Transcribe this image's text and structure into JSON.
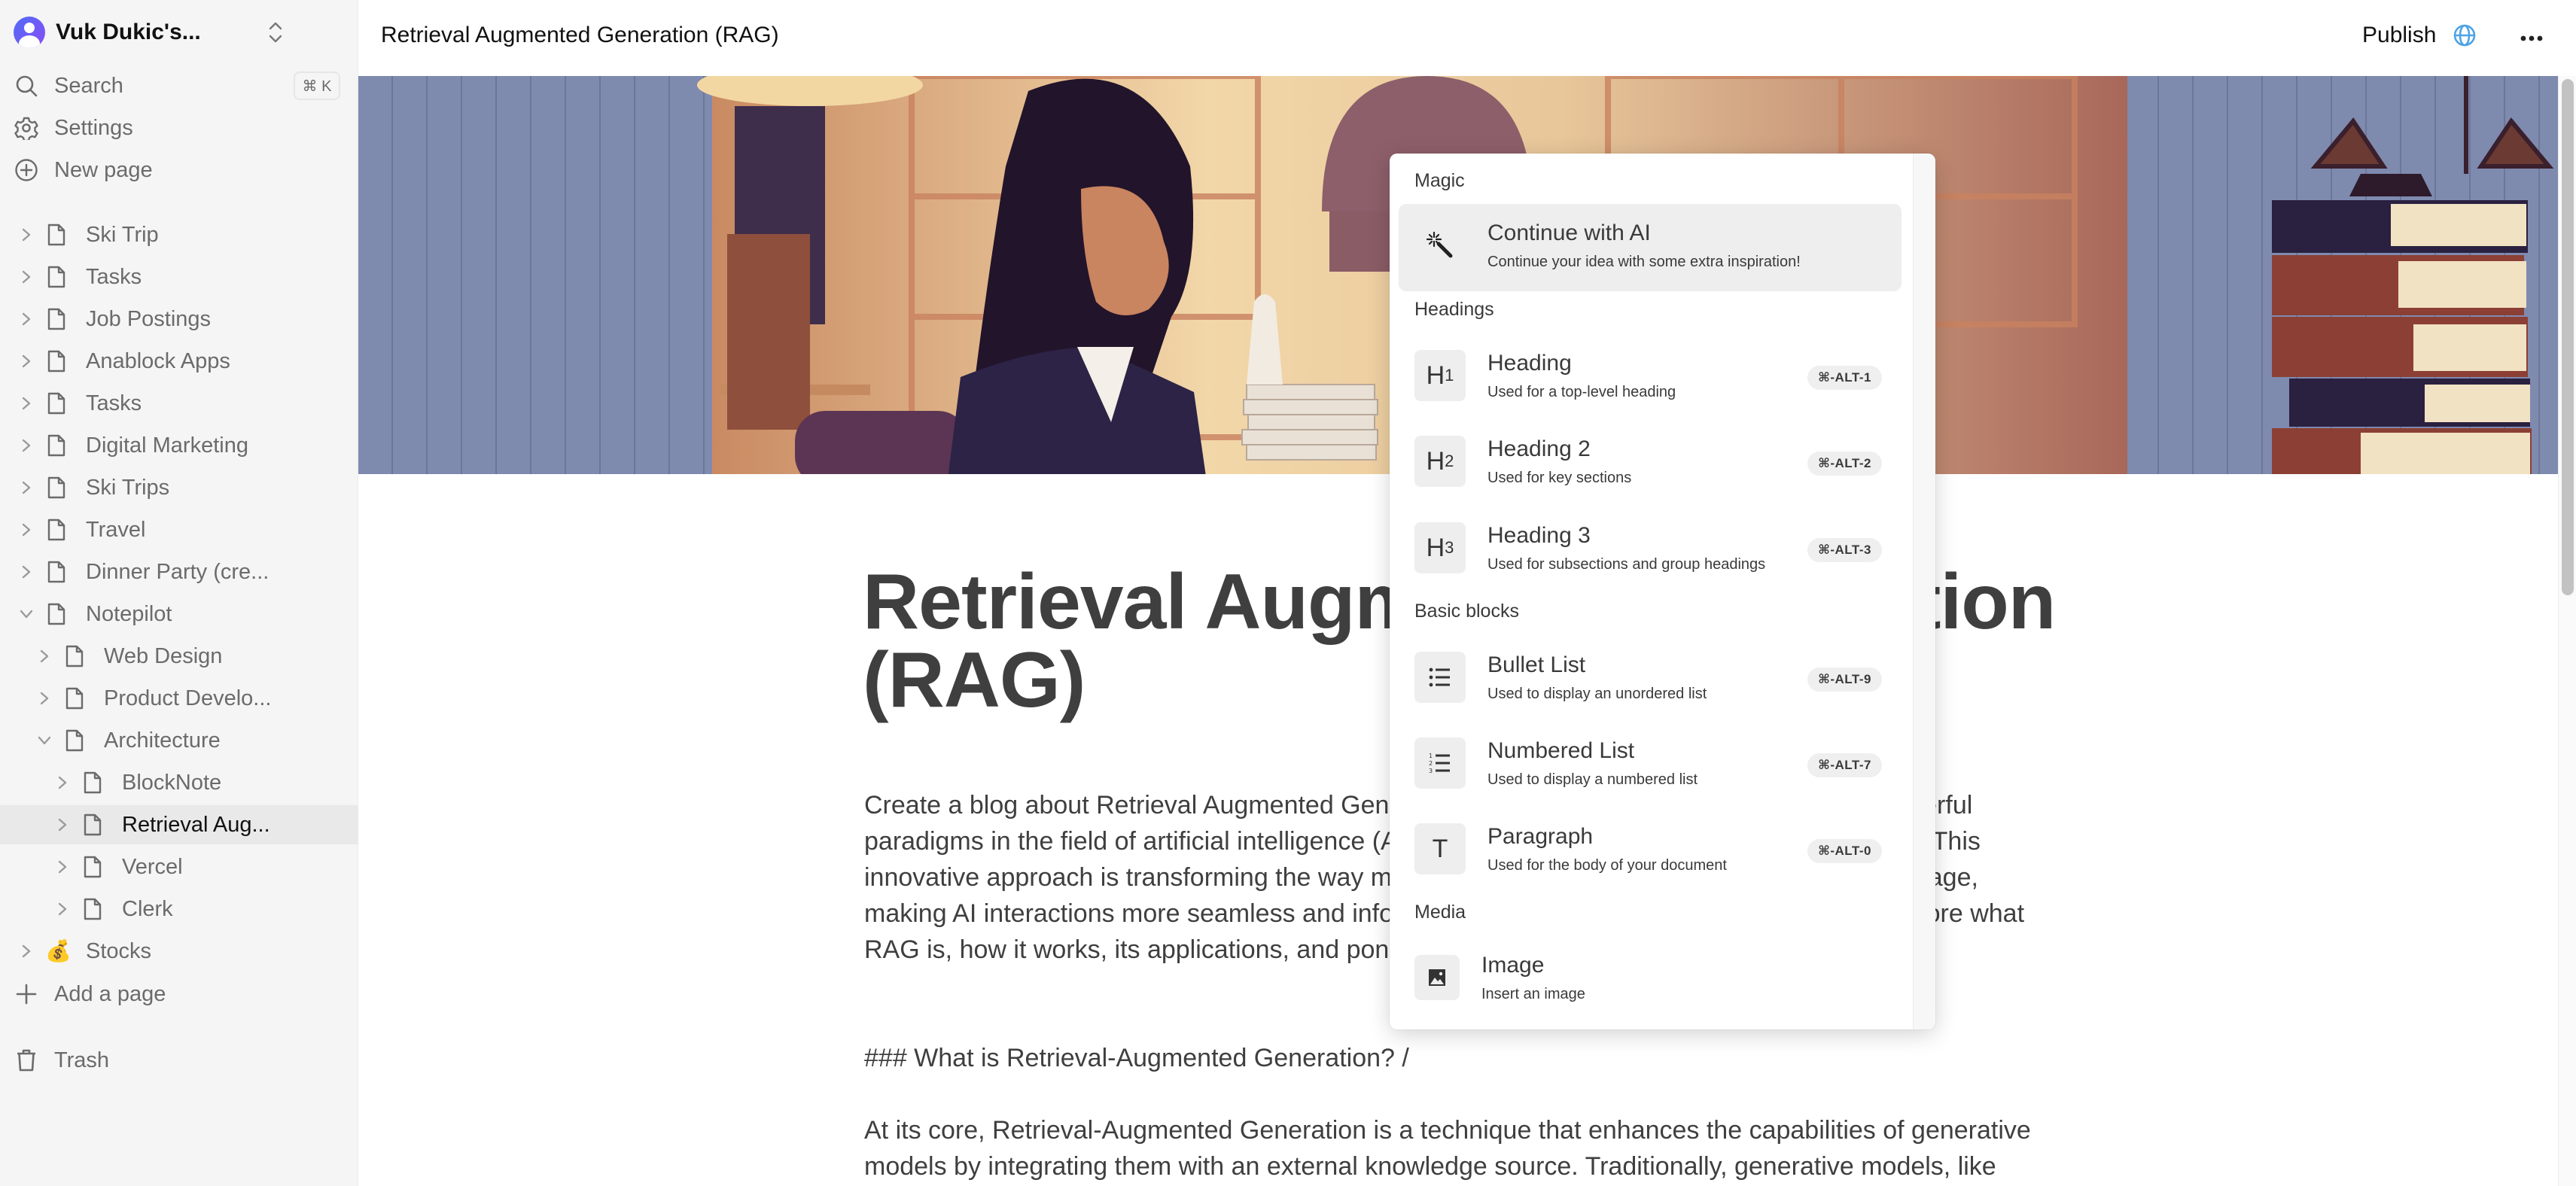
{
  "workspace": {
    "name": "Vuk Dukic's...",
    "avatar_icon": "user-avatar-icon",
    "switch_icon": "chevron-up-down-icon"
  },
  "sidebar": {
    "search": {
      "label": "Search",
      "shortcut": "⌘ K",
      "icon": "search-icon"
    },
    "settings": {
      "label": "Settings",
      "icon": "gear-icon"
    },
    "new_page": {
      "label": "New page",
      "icon": "plus-circle-icon"
    },
    "tree": [
      {
        "label": "Ski Trip",
        "depth": 0,
        "expanded": false,
        "icon": "page-icon"
      },
      {
        "label": "Tasks",
        "depth": 0,
        "expanded": false,
        "icon": "page-icon"
      },
      {
        "label": "Job Postings",
        "depth": 0,
        "expanded": false,
        "icon": "page-icon"
      },
      {
        "label": "Anablock Apps",
        "depth": 0,
        "expanded": false,
        "icon": "page-icon"
      },
      {
        "label": "Tasks",
        "depth": 0,
        "expanded": false,
        "icon": "page-icon"
      },
      {
        "label": "Digital Marketing",
        "depth": 0,
        "expanded": false,
        "icon": "page-icon"
      },
      {
        "label": "Ski Trips",
        "depth": 0,
        "expanded": false,
        "icon": "page-icon"
      },
      {
        "label": "Travel",
        "depth": 0,
        "expanded": false,
        "icon": "page-icon"
      },
      {
        "label": "Dinner Party (cre...",
        "depth": 0,
        "expanded": false,
        "icon": "page-icon"
      },
      {
        "label": "Notepilot",
        "depth": 0,
        "expanded": true,
        "icon": "page-icon"
      },
      {
        "label": "Web Design",
        "depth": 1,
        "expanded": false,
        "icon": "page-icon"
      },
      {
        "label": "Product Develo...",
        "depth": 1,
        "expanded": false,
        "icon": "page-icon"
      },
      {
        "label": "Architecture",
        "depth": 1,
        "expanded": true,
        "icon": "page-icon"
      },
      {
        "label": "BlockNote",
        "depth": 2,
        "expanded": false,
        "icon": "page-icon"
      },
      {
        "label": "Retrieval Aug...",
        "depth": 2,
        "expanded": false,
        "icon": "page-icon",
        "active": true
      },
      {
        "label": "Vercel",
        "depth": 2,
        "expanded": false,
        "icon": "page-icon"
      },
      {
        "label": "Clerk",
        "depth": 2,
        "expanded": false,
        "icon": "page-icon"
      },
      {
        "label": "Stocks",
        "depth": 0,
        "expanded": false,
        "icon": "money-bag-emoji",
        "emoji": "💰"
      }
    ],
    "add_page": {
      "label": "Add a page",
      "icon": "plus-icon"
    },
    "trash": {
      "label": "Trash",
      "icon": "trash-icon"
    }
  },
  "topbar": {
    "page_title": "Retrieval Augmented Generation (RAG)",
    "publish_label": "Publish",
    "publish_icon": "globe-icon",
    "more_icon": "more-horizontal-icon",
    "accent_color": "#4ea3e6"
  },
  "document": {
    "cover_image": "illustration of a lawyer at a desk with books and scales of justice",
    "title": "Retrieval Augmented Generation (RAG)",
    "paragraphs": [
      "Create a blog about Retrieval Augmented Generation (RAG) is a fascinating blend of two powerful paradigms in the field of artificial intelligence (AI): information retrieval and generative models. This innovative approach is transforming the way machines understand and generate human language, making AI interactions more seamless and informative than ever before. In this blog, we'll explore what RAG is, how it works, its applications, and ponder its future.",
      "### What is Retrieval-Augmented Generation? /",
      "At its core, Retrieval-Augmented Generation is a technique that enhances the capabilities of generative models by integrating them with an external knowledge source. Traditionally, generative models, like"
    ]
  },
  "slash_menu": {
    "groups": [
      {
        "label": "Magic",
        "items": [
          {
            "title": "Continue with AI",
            "subtitle": "Continue your idea with some extra inspiration!",
            "icon": "magic-wand-icon",
            "shortcut": "",
            "selected": true
          }
        ]
      },
      {
        "label": "Headings",
        "items": [
          {
            "title": "Heading",
            "subtitle": "Used for a top-level heading",
            "icon": "heading-1-icon",
            "glyph": "H",
            "glyph_sub": "1",
            "shortcut": "⌘-ALT-1"
          },
          {
            "title": "Heading 2",
            "subtitle": "Used for key sections",
            "icon": "heading-2-icon",
            "glyph": "H",
            "glyph_sub": "2",
            "shortcut": "⌘-ALT-2"
          },
          {
            "title": "Heading 3",
            "subtitle": "Used for subsections and group headings",
            "icon": "heading-3-icon",
            "glyph": "H",
            "glyph_sub": "3",
            "shortcut": "⌘-ALT-3"
          }
        ]
      },
      {
        "label": "Basic blocks",
        "items": [
          {
            "title": "Bullet List",
            "subtitle": "Used to display an unordered list",
            "icon": "bullet-list-icon",
            "shortcut": "⌘-ALT-9"
          },
          {
            "title": "Numbered List",
            "subtitle": "Used to display a numbered list",
            "icon": "numbered-list-icon",
            "shortcut": "⌘-ALT-7"
          },
          {
            "title": "Paragraph",
            "subtitle": "Used for the body of your document",
            "icon": "text-icon",
            "glyph": "T",
            "shortcut": "⌘-ALT-0"
          }
        ]
      },
      {
        "label": "Media",
        "items": [
          {
            "title": "Image",
            "subtitle": "Insert an image",
            "icon": "image-icon",
            "shortcut": ""
          }
        ]
      }
    ]
  },
  "scrollbar": {
    "position_fraction": 0.0,
    "visible_fraction": 0.47
  }
}
